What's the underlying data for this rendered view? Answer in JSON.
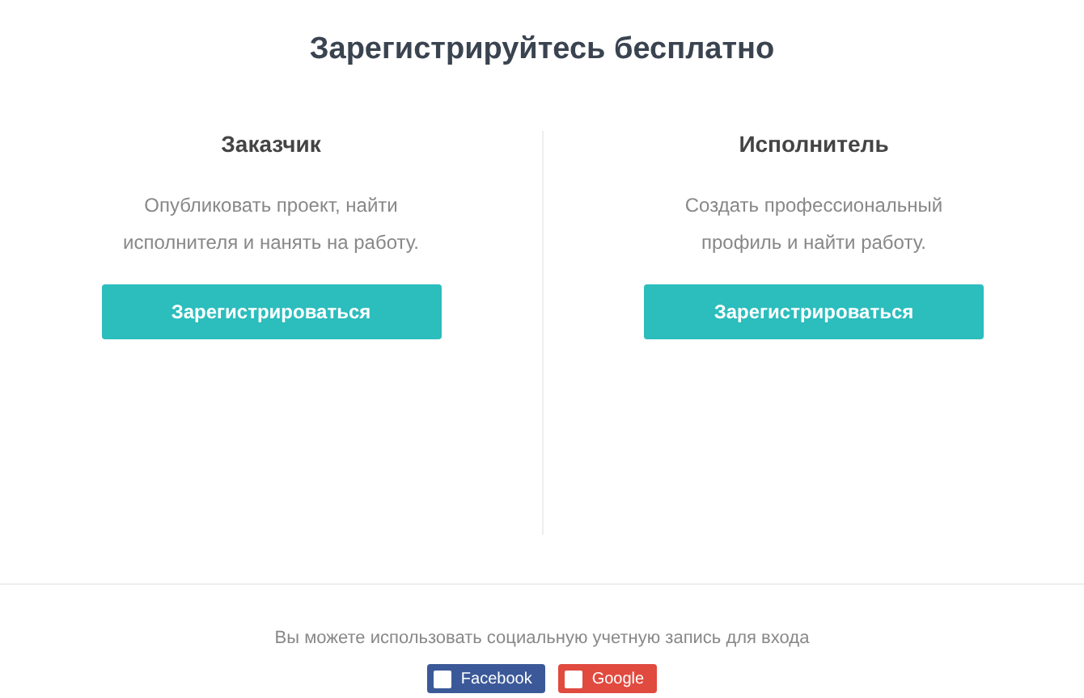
{
  "heading": "Зарегистрируйтесь бесплатно",
  "roles": [
    {
      "title": "Заказчик",
      "description": "Опубликовать проект, найти исполнителя и нанять на работу.",
      "button": "Зарегистрироваться"
    },
    {
      "title": "Исполнитель",
      "description": "Создать профессиональный профиль и найти работу.",
      "button": "Зарегистрироваться"
    }
  ],
  "social": {
    "text": "Вы можете использовать социальную учетную запись для входа",
    "buttons": [
      {
        "kind": "facebook",
        "label": "Facebook"
      },
      {
        "kind": "google",
        "label": "Google"
      }
    ]
  }
}
